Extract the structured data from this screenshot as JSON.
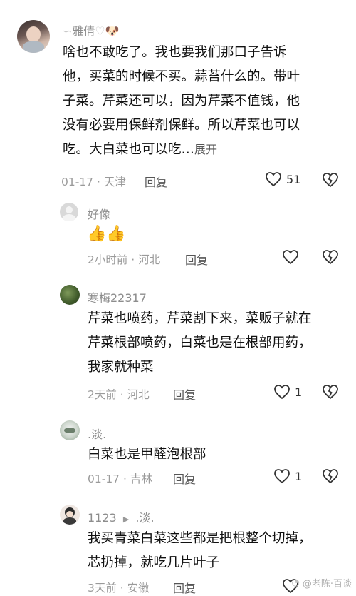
{
  "comments": [
    {
      "username": "雅倩",
      "text_lines": [
        "啥也不敢吃了。我也要我们那口子告诉",
        "他，买菜的时候不买。蒜苔什么的。带叶",
        "子菜。芹菜还可以，因为芹菜不值钱，他",
        "没有必要用保鲜剂保鲜。所以芹菜也可以",
        "吃。大白菜也可以吃…"
      ],
      "expand_label": "展开",
      "meta": "01-17 · 天津",
      "reply_label": "回复",
      "like_count": "51"
    },
    {
      "username": "好像",
      "emoji": "👍👍",
      "meta": "2小时前 · 河北",
      "reply_label": "回复"
    },
    {
      "username": "寒梅22317",
      "text_lines": [
        "芹菜也喷药，芹菜割下来，菜贩子就在",
        "芹菜根部喷药，白菜也是在根部用药，",
        "我家就种菜"
      ],
      "meta": "2天前 · 河北",
      "reply_label": "回复",
      "like_count": "1"
    },
    {
      "username": ".淡.",
      "text_lines": [
        "白菜也是甲醛泡根部"
      ],
      "meta": "01-17 · 吉林",
      "reply_label": "回复",
      "like_count": "1"
    },
    {
      "username": "1123",
      "reply_to": ".淡.",
      "text_lines": [
        "我买青菜白菜这些都是把根整个切掉，",
        "芯扔掉，就吃几片叶子"
      ],
      "meta": "3天前 · 安徽",
      "reply_label": "回复"
    }
  ],
  "watermark": "@老陈·百谈",
  "colors": {
    "meta_gray": "#9a9a9a",
    "text": "#111111"
  }
}
